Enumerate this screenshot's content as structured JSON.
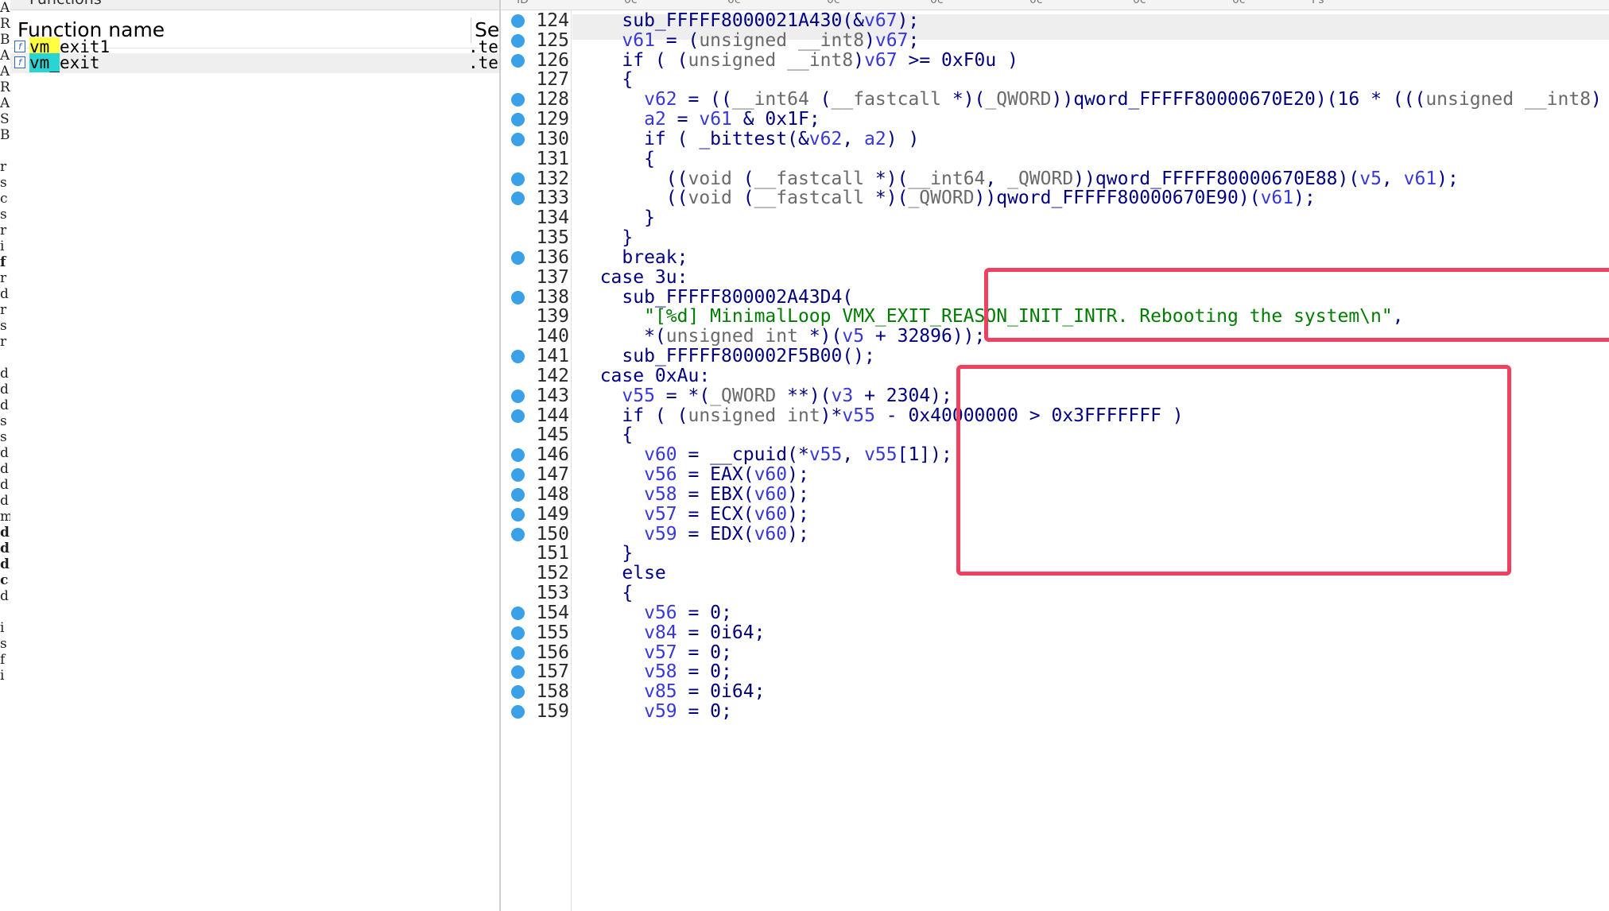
{
  "left_strip": {
    "chars": [
      "A",
      "R",
      "B",
      "A",
      "A",
      "R",
      "A",
      "S",
      "B",
      "r",
      "s",
      "c",
      "s",
      "r",
      "i",
      "f",
      "r",
      "d",
      "r",
      "s",
      "r",
      "d",
      "d",
      "d",
      "s",
      "s",
      "d",
      "d",
      "d",
      "d",
      "m",
      "d",
      "d",
      "d",
      "c",
      "d",
      "i",
      "s",
      "f",
      "i"
    ]
  },
  "functions": {
    "pane_title": "Functions",
    "columns": {
      "name": "Function name",
      "segment": "Se"
    },
    "rows": [
      {
        "prefix": "vm_",
        "suffix": "exit1",
        "segment": ".te",
        "highlight": "#ffff40",
        "selected": false
      },
      {
        "prefix": "vm_",
        "suffix": "exit",
        "segment": ".te",
        "highlight": "#28d4d4",
        "selected": true
      }
    ]
  },
  "tabs": [
    "ID",
    "0c",
    "0c",
    "0c",
    "0c",
    "0c",
    "0c",
    "0c",
    "Ps"
  ],
  "code": {
    "lines": [
      {
        "n": "124",
        "bp": true,
        "text": "    sub_FFFFF8000021A430(&v67);"
      },
      {
        "n": "125",
        "bp": true,
        "text": "    v61 = (unsigned __int8)v67;"
      },
      {
        "n": "126",
        "bp": true,
        "text": "    if ( (unsigned __int8)v67 >= 0xF0u )"
      },
      {
        "n": "127",
        "bp": false,
        "text": "    {"
      },
      {
        "n": "128",
        "bp": true,
        "text": "      v62 = ((__int64 (__fastcall *)(_QWORD))qword_FFFFF80000670E20)(16 * (((unsigned __int8)"
      },
      {
        "n": "129",
        "bp": true,
        "text": "      a2 = v61 & 0x1F;"
      },
      {
        "n": "130",
        "bp": true,
        "text": "      if ( _bittest(&v62, a2) )"
      },
      {
        "n": "131",
        "bp": false,
        "text": "      {"
      },
      {
        "n": "132",
        "bp": true,
        "text": "        ((void (__fastcall *)(__int64, _QWORD))qword_FFFFF80000670E88)(v5, v61);"
      },
      {
        "n": "133",
        "bp": true,
        "text": "        ((void (__fastcall *)(_QWORD))qword_FFFFF80000670E90)(v61);"
      },
      {
        "n": "134",
        "bp": false,
        "text": "      }"
      },
      {
        "n": "135",
        "bp": false,
        "text": "    }"
      },
      {
        "n": "136",
        "bp": true,
        "text": "    break;"
      },
      {
        "n": "137",
        "bp": false,
        "text": "  case 3u:"
      },
      {
        "n": "138",
        "bp": true,
        "text": "    sub_FFFFF800002A43D4("
      },
      {
        "n": "139",
        "bp": false,
        "text": "      \"[%d] MinimalLoop VMX_EXIT_REASON_INIT_INTR. Rebooting the system\\n\","
      },
      {
        "n": "140",
        "bp": false,
        "text": "      *(unsigned int *)(v5 + 32896));"
      },
      {
        "n": "141",
        "bp": true,
        "text": "    sub_FFFFF800002F5B00();"
      },
      {
        "n": "142",
        "bp": false,
        "text": "  case 0xAu:"
      },
      {
        "n": "143",
        "bp": true,
        "text": "    v55 = *(_QWORD **)(v3 + 2304);"
      },
      {
        "n": "144",
        "bp": true,
        "text": "    if ( (unsigned int)*v55 - 0x40000000 > 0x3FFFFFFF )"
      },
      {
        "n": "145",
        "bp": false,
        "text": "    {"
      },
      {
        "n": "146",
        "bp": true,
        "text": "      v60 = __cpuid(*v55, v55[1]);"
      },
      {
        "n": "147",
        "bp": true,
        "text": "      v56 = EAX(v60);"
      },
      {
        "n": "148",
        "bp": true,
        "text": "      v58 = EBX(v60);"
      },
      {
        "n": "149",
        "bp": true,
        "text": "      v57 = ECX(v60);"
      },
      {
        "n": "150",
        "bp": true,
        "text": "      v59 = EDX(v60);"
      },
      {
        "n": "151",
        "bp": false,
        "text": "    }"
      },
      {
        "n": "152",
        "bp": false,
        "text": "    else"
      },
      {
        "n": "153",
        "bp": false,
        "text": "    {"
      },
      {
        "n": "154",
        "bp": true,
        "text": "      v56 = 0;"
      },
      {
        "n": "155",
        "bp": true,
        "text": "      v84 = 0i64;"
      },
      {
        "n": "156",
        "bp": true,
        "text": "      v57 = 0;"
      },
      {
        "n": "157",
        "bp": true,
        "text": "      v58 = 0;"
      },
      {
        "n": "158",
        "bp": true,
        "text": "      v85 = 0i64;"
      },
      {
        "n": "159",
        "bp": true,
        "text": "      v59 = 0;"
      }
    ]
  },
  "annotation_color": "#f04060",
  "breakpoint_color": "#3aa0e8"
}
